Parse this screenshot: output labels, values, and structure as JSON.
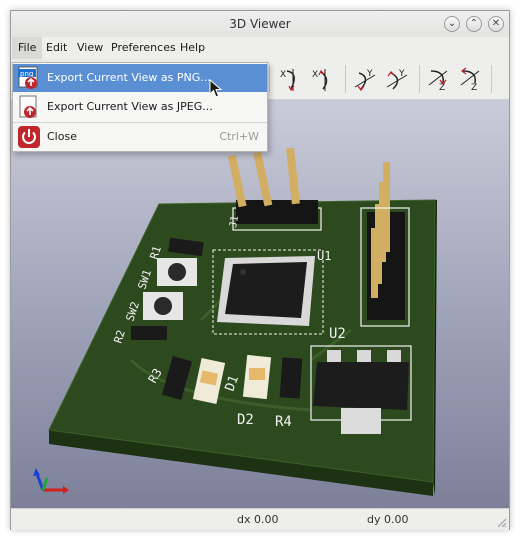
{
  "window": {
    "title": "3D Viewer",
    "controls": {
      "minimize": "⌄",
      "maximize": "⌃",
      "close": "✕"
    }
  },
  "menubar": {
    "items": [
      {
        "label": "File"
      },
      {
        "label": "Edit"
      },
      {
        "label": "View"
      },
      {
        "label": "Preferences"
      },
      {
        "label": "Help"
      }
    ]
  },
  "file_menu": {
    "items": [
      {
        "label": "Export Current View as PNG...",
        "icon": "png-export-icon",
        "shortcut": ""
      },
      {
        "label": "Export Current View as JPEG...",
        "icon": "jpeg-export-icon",
        "shortcut": ""
      },
      {
        "label": "Close",
        "icon": "power-icon",
        "shortcut": "Ctrl+W"
      }
    ],
    "png_badge": "png"
  },
  "toolbar": {
    "icons": [
      "rotate-x-cw-icon",
      "rotate-x-ccw-icon",
      "rotate-y-cw-icon",
      "rotate-y-ccw-icon",
      "rotate-z-cw-icon",
      "rotate-z-ccw-icon"
    ],
    "axis_labels": {
      "x": "X",
      "y": "Y",
      "z": "Z"
    }
  },
  "pcb": {
    "labels": {
      "j1": "J1",
      "u1": "U1",
      "u2": "U2",
      "r1": "R1",
      "sw1": "SW1",
      "sw2": "SW2",
      "r2": "R2",
      "r3": "R3",
      "d1": "D1",
      "d2": "D2",
      "r4": "R4"
    },
    "colors": {
      "board": "#2d4a1f",
      "silkscreen": "#f2f2f2",
      "background_top": "#c9cbd8",
      "background_bottom": "#7c8099"
    }
  },
  "status": {
    "dx": "dx 0.00",
    "dy": "dy 0.00"
  },
  "colors": {
    "highlight": "#5a8fd4",
    "close_icon": "#c0272d"
  }
}
